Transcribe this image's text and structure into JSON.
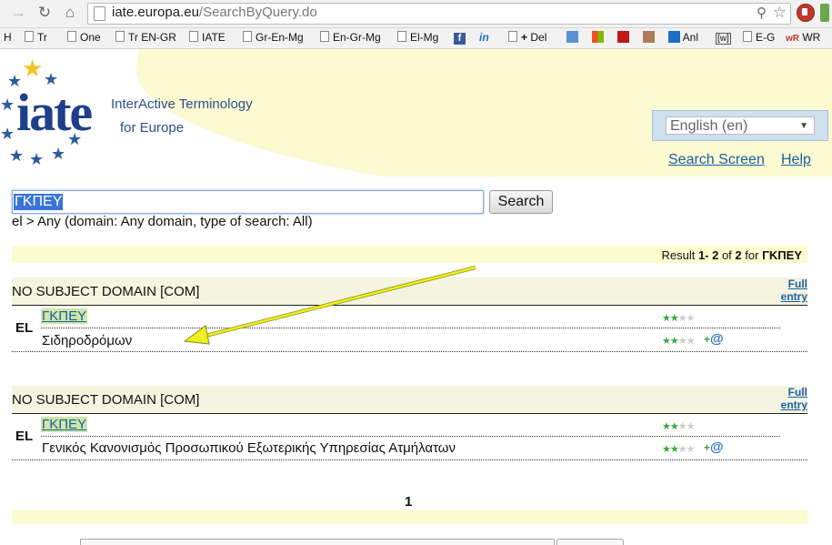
{
  "browser": {
    "url_domain": "iate.europa.eu",
    "url_path": "/SearchByQuery.do"
  },
  "bookmarks": [
    {
      "label": "H"
    },
    {
      "label": "Tr"
    },
    {
      "label": "One"
    },
    {
      "label": "Tr EN-GR"
    },
    {
      "label": "IATE"
    },
    {
      "label": "Gr-En-Mg"
    },
    {
      "label": "En-Gr-Mg"
    },
    {
      "label": "El-Mg"
    },
    {
      "label": "Del"
    },
    {
      "label": "Anl"
    },
    {
      "label": "E-G"
    },
    {
      "label": "WR"
    }
  ],
  "header": {
    "logo_text": "iate",
    "subtitle_line1": "InterActive Terminology",
    "subtitle_line2": "for Europe",
    "language_selected": "English (en)",
    "search_screen_link": "Search Screen",
    "help_link": "Help"
  },
  "search": {
    "query": "ΓΚΠΕΥ",
    "button_label": "Search",
    "info": "el > Any (domain: Any domain, type of search: All)"
  },
  "results": {
    "prefix": "Result ",
    "range": "1- 2",
    "of": " of ",
    "total": "2",
    "for": " for ",
    "term": "ΓΚΠΕΥ",
    "entries": [
      {
        "domain": "NO SUBJECT DOMAIN [COM]",
        "full_entry_line1": "Full",
        "full_entry_line2": "entry",
        "lang": "EL",
        "abbr": "ΓΚΠΕΥ",
        "full_term": "Σιδηροδρόμων"
      },
      {
        "domain": "NO SUBJECT DOMAIN [COM]",
        "full_entry_line1": "Full",
        "full_entry_line2": "entry",
        "lang": "EL",
        "abbr": "ΓΚΠΕΥ",
        "full_term": "Γενικός Κανονισμός Προσωπικού Εξωτερικής Υπηρεσίας Ατμήλατων"
      }
    ],
    "reliability_stars": 2,
    "reliability_max": 4,
    "page_number": "1"
  },
  "colors": {
    "annotation_arrow": "#f0f020",
    "link": "#1a5fa8",
    "highlight": "#cfe6a6",
    "result_bar": "#fdfbd0"
  }
}
